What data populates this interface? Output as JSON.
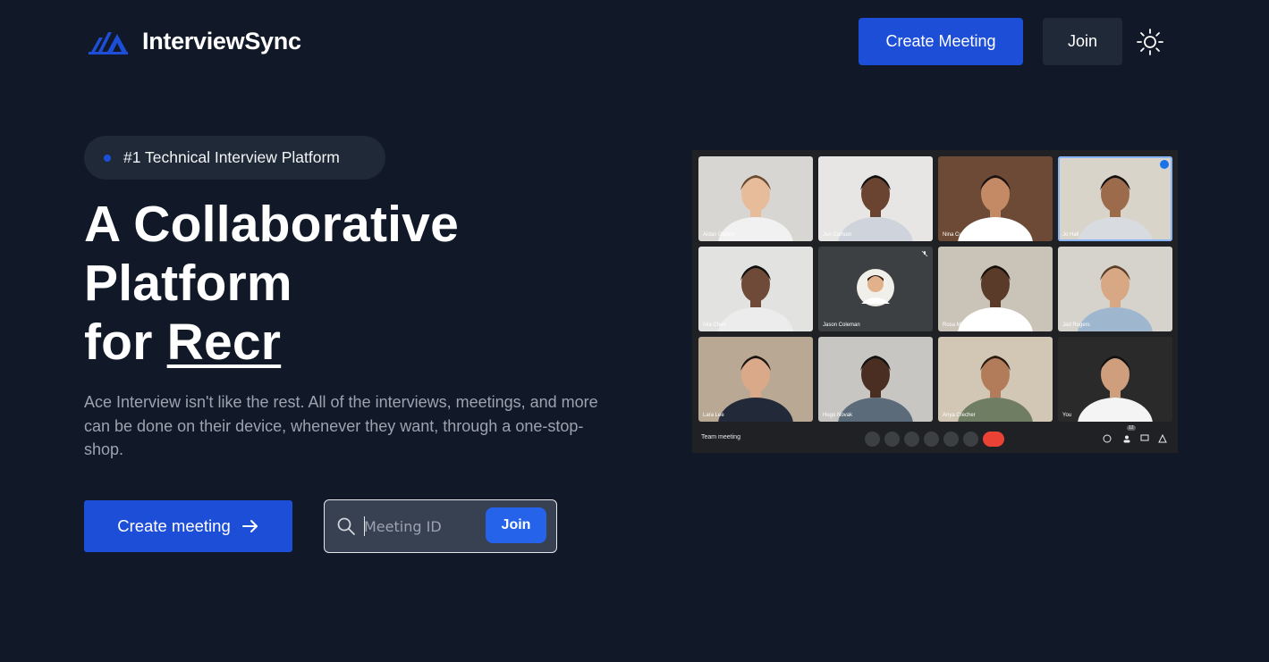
{
  "header": {
    "brand_name": "InterviewSync",
    "logo_icon": "triangles-logo-icon",
    "create_meeting_label": "Create Meeting",
    "join_label": "Join",
    "theme_toggle_icon": "sun-icon"
  },
  "hero": {
    "badge_text": "#1 Technical Interview Platform",
    "title_line1": "A Collaborative",
    "title_line2": "Platform",
    "title_line3_prefix": "for",
    "title_typed_word": "Recr",
    "description": "Ace Interview isn't like the rest. All of the interviews, meetings, and more can be done on their device, whenever they want, through a one-stop-shop.",
    "create_meeting_label": "Create meeting",
    "create_meeting_icon": "arrow-right-icon",
    "join_input_placeholder": "Meeting ID",
    "join_input_value": "",
    "join_button_label": "Join",
    "search_icon": "search-icon"
  },
  "preview": {
    "meeting_title": "Team meeting",
    "people_count": "12",
    "participants": [
      {
        "name": "Aidan Garner"
      },
      {
        "name": "Jon Carlson"
      },
      {
        "name": "Nina Curry"
      },
      {
        "name": "Jo Hall"
      },
      {
        "name": "Mia Chen"
      },
      {
        "name": "Jason Coleman"
      },
      {
        "name": "Rosa Michaels"
      },
      {
        "name": "Jad Rogers"
      },
      {
        "name": "Lara Lee"
      },
      {
        "name": "Hugo Novak"
      },
      {
        "name": "Anya Crecher"
      },
      {
        "name": "You"
      }
    ]
  },
  "colors": {
    "background": "#111827",
    "primary": "#1d4ed8",
    "surface": "#1f2937",
    "muted_text": "#9ca3af"
  }
}
